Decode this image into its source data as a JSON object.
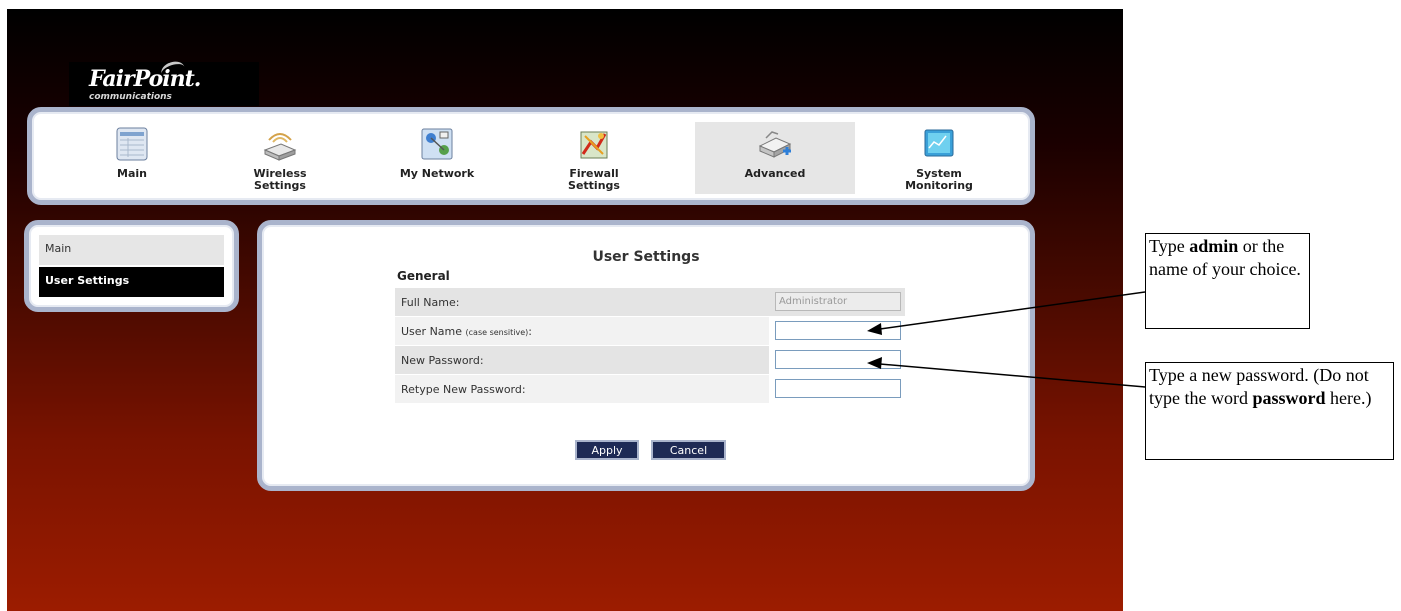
{
  "logo": {
    "brand": "FairPoint.",
    "sub": "communications"
  },
  "nav": [
    {
      "label": "Main",
      "icon": "main-grid-icon",
      "active": false
    },
    {
      "label": "Wireless Settings",
      "icon": "wireless-router-icon",
      "active": false
    },
    {
      "label": "My Network",
      "icon": "network-map-icon",
      "active": false
    },
    {
      "label": "Firewall Settings",
      "icon": "firewall-icon",
      "active": false
    },
    {
      "label": "Advanced",
      "icon": "advanced-router-icon",
      "active": true
    },
    {
      "label": "System Monitoring",
      "icon": "monitor-icon",
      "active": false
    }
  ],
  "sidebar": {
    "items": [
      {
        "label": "Main",
        "active": false
      },
      {
        "label": "User Settings",
        "active": true
      }
    ]
  },
  "panel": {
    "title": "User Settings",
    "section": "General",
    "rows": [
      {
        "label": "Full Name:",
        "note": "",
        "value": "Administrator",
        "disabled": true
      },
      {
        "label": "User Name ",
        "note": "(case sensitive)",
        "suffix": ":",
        "value": "",
        "disabled": false
      },
      {
        "label": "New Password:",
        "note": "",
        "value": "",
        "disabled": false
      },
      {
        "label": "Retype New Password:",
        "note": "",
        "value": "",
        "disabled": false
      }
    ],
    "apply_label": "Apply",
    "cancel_label": "Cancel"
  },
  "callouts": {
    "username": {
      "pre": "Type ",
      "bold": "admin",
      "post": " or the name of your choice."
    },
    "password": {
      "pre": "Type a new password. (Do not type the word ",
      "bold": "password",
      "post": " here.)"
    }
  },
  "colors": {
    "nav_frame": "#aab4cc",
    "button_bg": "#1e2a55",
    "side_active_bg": "#000000",
    "row_shade": "#e4e4e4",
    "row_light": "#f2f2f2"
  }
}
